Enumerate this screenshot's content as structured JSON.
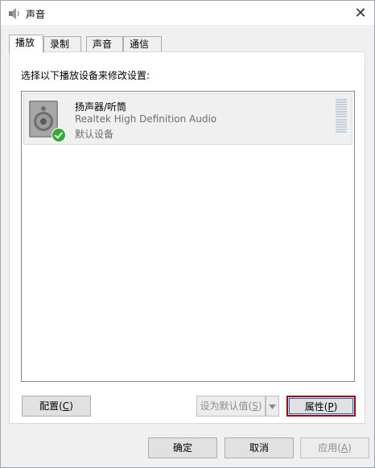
{
  "window": {
    "title": "声音",
    "close_glyph": "✕"
  },
  "tabs": [
    {
      "label": "播放",
      "active": true
    },
    {
      "label": "录制",
      "active": false
    },
    {
      "label": "声音",
      "active": false
    },
    {
      "label": "通信",
      "active": false
    }
  ],
  "playback": {
    "instruction": "选择以下播放设备来修改设置:",
    "devices": [
      {
        "name": "扬声器/听筒",
        "driver": "Realtek High Definition Audio",
        "status": "默认设备",
        "icon": "speaker-icon",
        "badge": "check-badge-icon"
      }
    ],
    "buttons": {
      "configure_text": "配置(",
      "configure_key": "C",
      "configure_end": ")",
      "set_default_text": "设为默认值(",
      "set_default_key": "S",
      "set_default_end": ")",
      "properties_text": "属性(",
      "properties_key": "P",
      "properties_end": ")"
    }
  },
  "footer": {
    "ok": "确定",
    "cancel": "取消",
    "apply_text": "应用(",
    "apply_key": "A",
    "apply_end": ")"
  },
  "colors": {
    "highlight_border": "#b40000",
    "focus_border": "#0078d7",
    "check_green": "#2eae2e"
  }
}
